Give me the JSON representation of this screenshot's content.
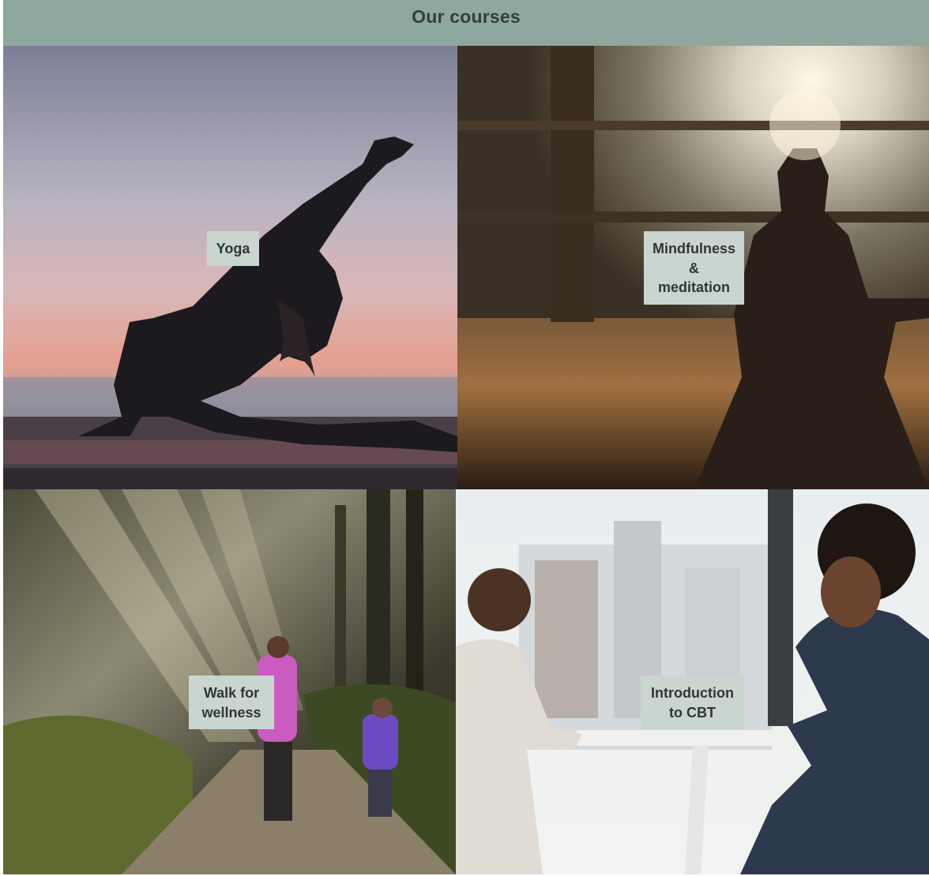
{
  "header": {
    "title": "Our courses"
  },
  "courses": [
    {
      "label": "Yoga",
      "image_icon": "yoga-pose-silhouette"
    },
    {
      "label": "Mindfulness\n&\nmeditation",
      "image_icon": "meditation-silhouette"
    },
    {
      "label": "Walk for\nwellness",
      "image_icon": "forest-walk"
    },
    {
      "label": "Introduction\nto CBT",
      "image_icon": "therapy-conversation"
    }
  ],
  "colors": {
    "header_bg": "#8fa89f",
    "label_bg": "#c9d6d0",
    "title_text": "#353d3a"
  }
}
